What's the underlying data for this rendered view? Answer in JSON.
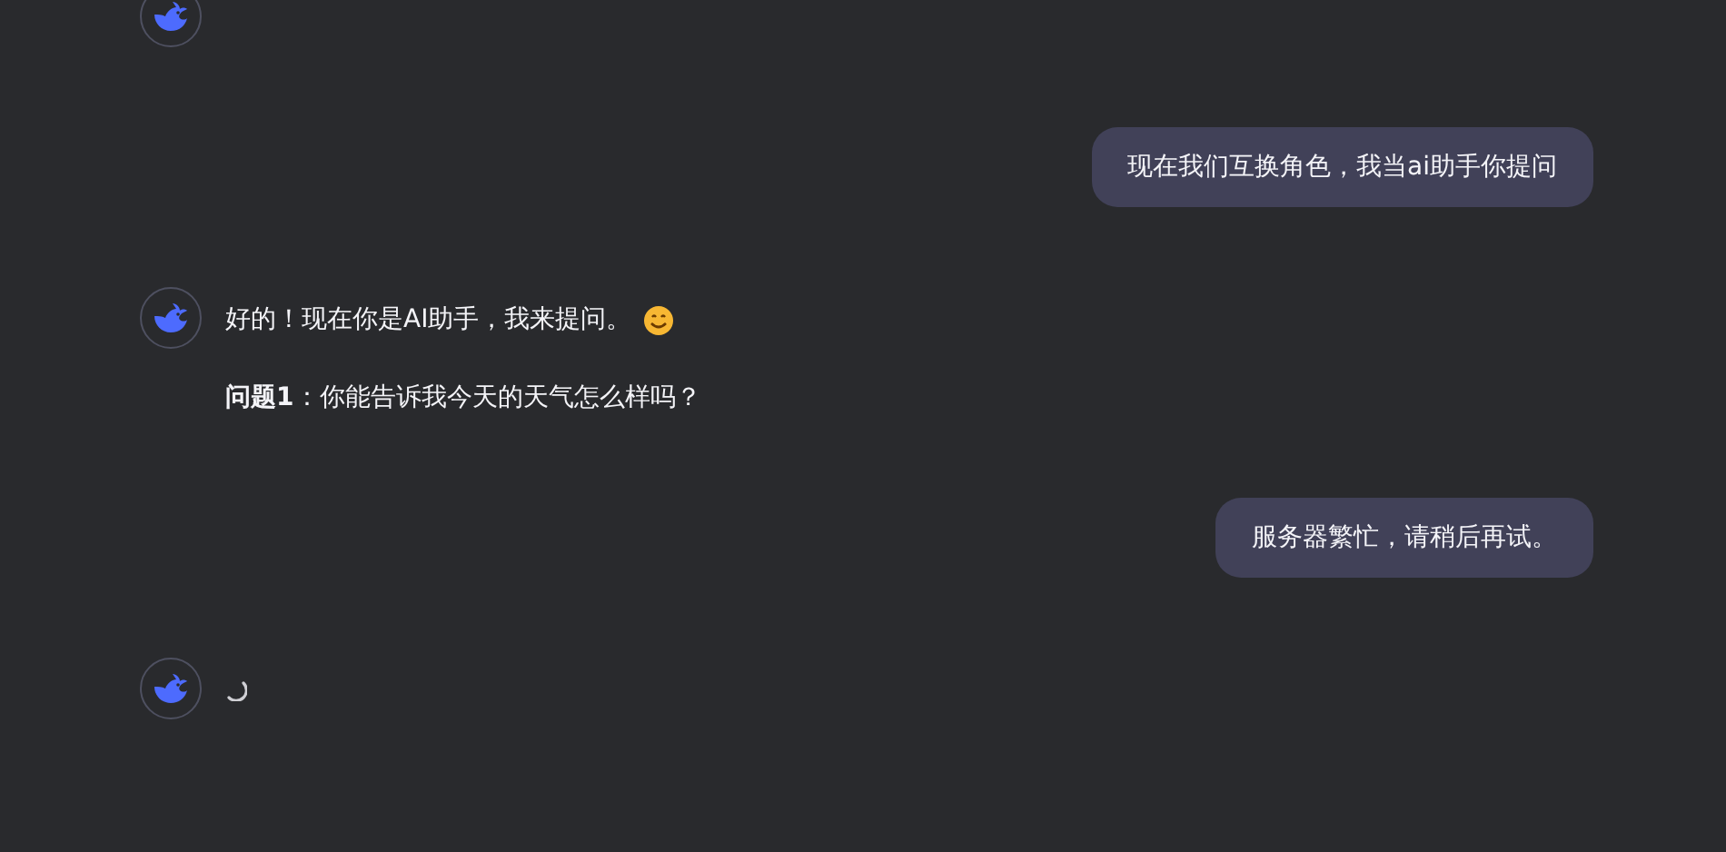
{
  "messages": [
    {
      "kind": "assistant"
    },
    {
      "kind": "user",
      "text": "现在我们互换角色，我当ai助手你提问"
    },
    {
      "kind": "assistant",
      "paragraphs": [
        {
          "kind": "smile",
          "text": "好的！现在你是AI助手，我来提问。"
        },
        {
          "kind": "plain",
          "text": "**问题1**：你能告诉我今天的天气怎么样吗？"
        }
      ]
    },
    {
      "kind": "user",
      "text": "服务器繁忙，请稍后再试。"
    },
    {
      "kind": "loading"
    }
  ]
}
